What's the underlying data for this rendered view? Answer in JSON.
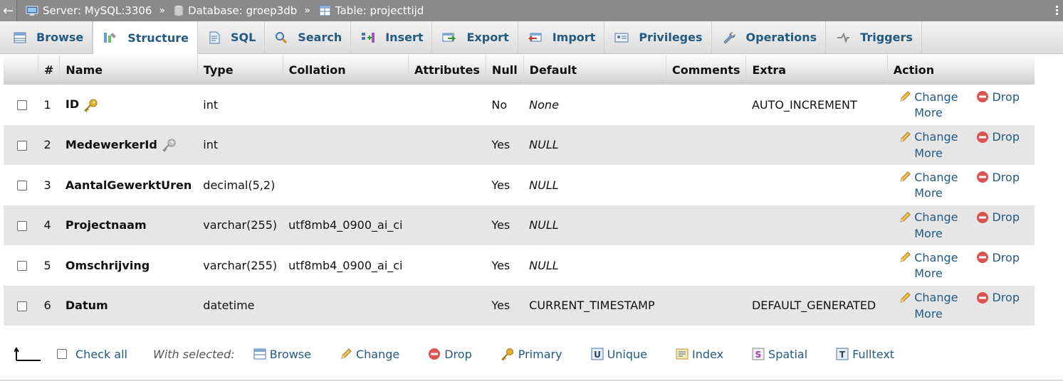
{
  "breadcrumb": {
    "back": "←",
    "server": "Server: MySQL:3306",
    "database": "Database: groep3db",
    "table": "Table: projecttijd",
    "separator": "»"
  },
  "tabs": [
    {
      "label": "Browse",
      "icon": "browse-icon"
    },
    {
      "label": "Structure",
      "icon": "structure-icon",
      "active": true
    },
    {
      "label": "SQL",
      "icon": "sql-icon"
    },
    {
      "label": "Search",
      "icon": "search-icon"
    },
    {
      "label": "Insert",
      "icon": "insert-icon"
    },
    {
      "label": "Export",
      "icon": "export-icon"
    },
    {
      "label": "Import",
      "icon": "import-icon"
    },
    {
      "label": "Privileges",
      "icon": "privileges-icon"
    },
    {
      "label": "Operations",
      "icon": "wrench-icon"
    },
    {
      "label": "Triggers",
      "icon": "triggers-icon"
    }
  ],
  "columns": {
    "num": "#",
    "name": "Name",
    "type": "Type",
    "collation": "Collation",
    "attributes": "Attributes",
    "null": "Null",
    "default": "Default",
    "comments": "Comments",
    "extra": "Extra",
    "action": "Action"
  },
  "rows": [
    {
      "num": "1",
      "name": "ID",
      "key": "primary",
      "type": "int",
      "collation": "",
      "attributes": "",
      "null": "No",
      "default": "None",
      "default_italic": true,
      "comments": "",
      "extra": "AUTO_INCREMENT"
    },
    {
      "num": "2",
      "name": "MedewerkerId",
      "key": "index",
      "type": "int",
      "collation": "",
      "attributes": "",
      "null": "Yes",
      "default": "NULL",
      "default_italic": true,
      "comments": "",
      "extra": ""
    },
    {
      "num": "3",
      "name": "AantalGewerktUren",
      "key": "",
      "type": "decimal(5,2)",
      "collation": "",
      "attributes": "",
      "null": "Yes",
      "default": "NULL",
      "default_italic": true,
      "comments": "",
      "extra": ""
    },
    {
      "num": "4",
      "name": "Projectnaam",
      "key": "",
      "type": "varchar(255)",
      "collation": "utf8mb4_0900_ai_ci",
      "attributes": "",
      "null": "Yes",
      "default": "NULL",
      "default_italic": true,
      "comments": "",
      "extra": ""
    },
    {
      "num": "5",
      "name": "Omschrijving",
      "key": "",
      "type": "varchar(255)",
      "collation": "utf8mb4_0900_ai_ci",
      "attributes": "",
      "null": "Yes",
      "default": "NULL",
      "default_italic": true,
      "comments": "",
      "extra": ""
    },
    {
      "num": "6",
      "name": "Datum",
      "key": "",
      "type": "datetime",
      "collation": "",
      "attributes": "",
      "null": "Yes",
      "default": "CURRENT_TIMESTAMP",
      "default_italic": false,
      "comments": "",
      "extra": "DEFAULT_GENERATED"
    }
  ],
  "row_actions": {
    "change": "Change",
    "drop": "Drop",
    "more": "More"
  },
  "bulk": {
    "check_all": "Check all",
    "with_selected": "With selected:",
    "actions": [
      {
        "label": "Browse",
        "icon": "browse-icon"
      },
      {
        "label": "Change",
        "icon": "pencil-icon"
      },
      {
        "label": "Drop",
        "icon": "drop-icon"
      },
      {
        "label": "Primary",
        "icon": "key-icon"
      },
      {
        "label": "Unique",
        "icon": "unique-icon"
      },
      {
        "label": "Index",
        "icon": "index-icon"
      },
      {
        "label": "Spatial",
        "icon": "spatial-icon"
      },
      {
        "label": "Fulltext",
        "icon": "fulltext-icon"
      }
    ]
  },
  "colors": {
    "link": "#235a81",
    "topbar": "#8a8a8a",
    "row_alt": "#e6e6e6",
    "drop_red": "#d9534f",
    "key_gold": "#e0b02a"
  }
}
